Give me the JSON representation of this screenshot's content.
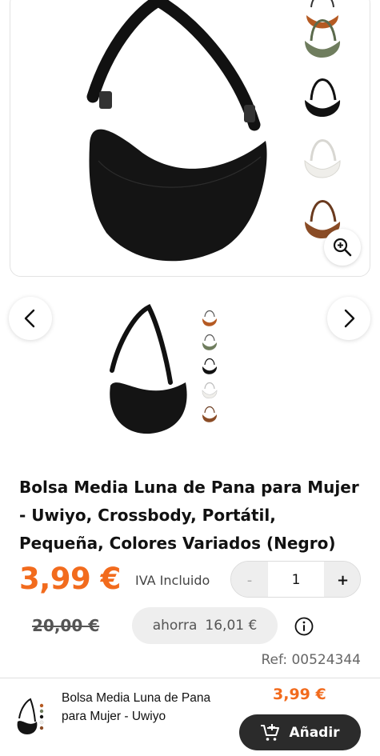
{
  "product": {
    "title": "Bolsa Media Luna de Pana para Mujer - Uwiyo, Crossbody, Portátil, Pequeña, Colores Variados (Negro)",
    "price": "3,99 €",
    "tax_note": "IVA Incluido",
    "old_price": "20,00 €",
    "savings_label": "ahorra",
    "savings_value": "16,01 €",
    "ref": "Ref: 00524344"
  },
  "quantity": {
    "minus_label": "-",
    "value": "1",
    "plus_label": "+"
  },
  "gallery": {
    "swatch_colors": [
      "#b55a22",
      "#6f7d5e",
      "#111111",
      "#efeeea",
      "#8a4c26"
    ]
  },
  "bottom_bar": {
    "name": "Bolsa Media Luna de Pana para Mujer - Uwiyo",
    "price": "3,99 €",
    "add_label": "Añadir"
  },
  "colors": {
    "accent": "#f26b1d",
    "button_dark": "#2b2b2b"
  }
}
